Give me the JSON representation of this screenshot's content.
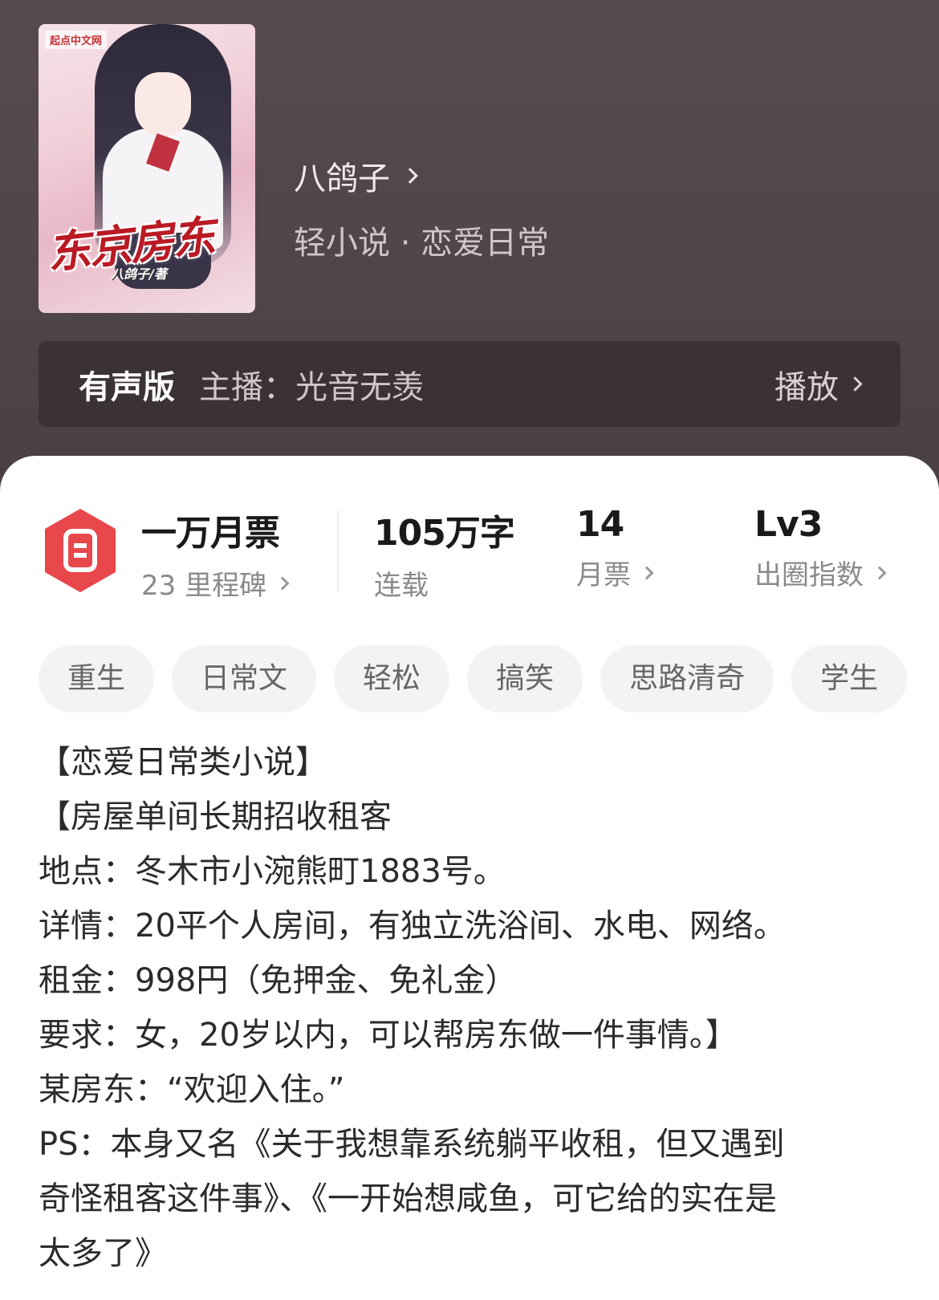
{
  "book": {
    "cover": {
      "title": "东京房东",
      "author_line": "八鸽子/著",
      "publisher_badge": "起点中文网"
    },
    "author": "八鸽子",
    "genre": "轻小说 · 恋爱日常"
  },
  "audio": {
    "tag": "有声版",
    "host": "主播：光音无羡",
    "play_label": "播放"
  },
  "stats": {
    "ticket_title": "一万月票",
    "ticket_sub": "23 里程碑",
    "words_value": "105万字",
    "words_label": "连载",
    "monthly_value": "14",
    "monthly_label": "月票",
    "level_value": "Lv3",
    "level_label": "出圈指数"
  },
  "tags": [
    "重生",
    "日常文",
    "轻松",
    "搞笑",
    "思路清奇",
    "学生"
  ],
  "description": [
    "【恋爱日常类小说】",
    "【房屋单间长期招收租客",
    "地点：冬木市小涴熊町1883号。",
    "详情：20平个人房间，有独立洗浴间、水电、网络。",
    "租金：998円（免押金、免礼金）",
    "要求：女，20岁以内，可以帮房东做一件事情。】",
    "某房东：“欢迎入住。”",
    "PS：本身又名《关于我想靠系统躺平收租，但又遇到",
    "奇怪租客这件事》、《一开始想咸鱼，可它给的实在是",
    "太多了》"
  ],
  "colors": {
    "accent_red": "#e8474c",
    "hero_bg": "#544849",
    "audio_bar_bg": "#3b3234"
  }
}
